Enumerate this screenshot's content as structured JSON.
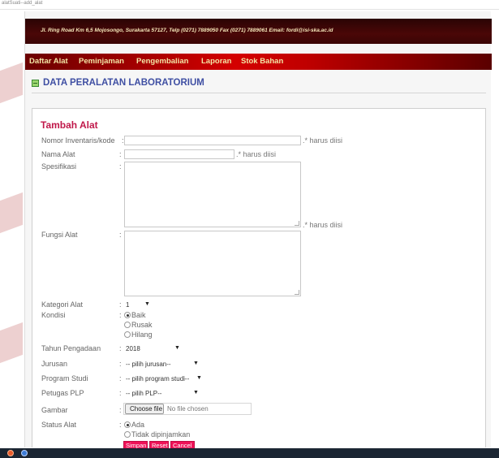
{
  "browser": {
    "url": "alatSuati--add_alat"
  },
  "header": {
    "address": "Jl. Ring Road Km 6,5 Mojosongo, Surakarta 57127, Telp (0271) 7889050 Fax (0271) 7889061 Email: fordi@isi-ska.ac.id"
  },
  "nav": {
    "items": [
      {
        "label": "Daftar Alat"
      },
      {
        "label": "Peminjaman"
      },
      {
        "label": "Pengembalian"
      },
      {
        "label": "Laporan"
      },
      {
        "label": "Stok Bahan"
      }
    ]
  },
  "page": {
    "title": "DATA PERALATAN LABORATORIUM"
  },
  "form": {
    "title": "Tambah Alat",
    "colon": ":",
    "nomor": {
      "label": "Nomor Inventaris/kode",
      "value": "",
      "required": ".* harus diisi"
    },
    "nama": {
      "label": "Nama Alat",
      "value": "",
      "required": ".* harus diisi"
    },
    "spesifikasi": {
      "label": "Spesifikasi",
      "value": "",
      "required": ".* harus diisi"
    },
    "fungsi": {
      "label": "Fungsi Alat",
      "value": ""
    },
    "kategori": {
      "label": "Kategori Alat",
      "selected": "1",
      "arrow": "▼"
    },
    "kondisi": {
      "label": "Kondisi",
      "options": [
        {
          "label": "Baik",
          "checked": true
        },
        {
          "label": "Rusak",
          "checked": false
        },
        {
          "label": "Hilang",
          "checked": false
        }
      ]
    },
    "tahun": {
      "label": "Tahun Pengadaan",
      "selected": "2018",
      "arrow": "▼"
    },
    "jurusan": {
      "label": "Jurusan",
      "selected": "-- pilih jurusan--",
      "arrow": "▼"
    },
    "prodi": {
      "label": "Program Studi",
      "selected": "-- pilih program studi--",
      "arrow": "▼"
    },
    "petugas": {
      "label": "Petugas PLP",
      "selected": "-- pilih PLP--",
      "arrow": "▼"
    },
    "gambar": {
      "label": "Gambar",
      "button": "Choose file",
      "status": "No file chosen"
    },
    "status": {
      "label": "Status Alat",
      "options": [
        {
          "label": "Ada",
          "checked": true
        },
        {
          "label": "Tidak dipinjamkan",
          "checked": false
        }
      ]
    },
    "actions": {
      "submit": "Simpan",
      "reset": "Reset",
      "cancel": "Cancel"
    }
  },
  "colors": {
    "header_bg": "#3a0505",
    "nav_red": "#d40000",
    "nav_text": "#f3e6a6",
    "title_blue": "#3f4fa3",
    "form_title": "#c0184a",
    "button_pink": "#ef1258"
  }
}
